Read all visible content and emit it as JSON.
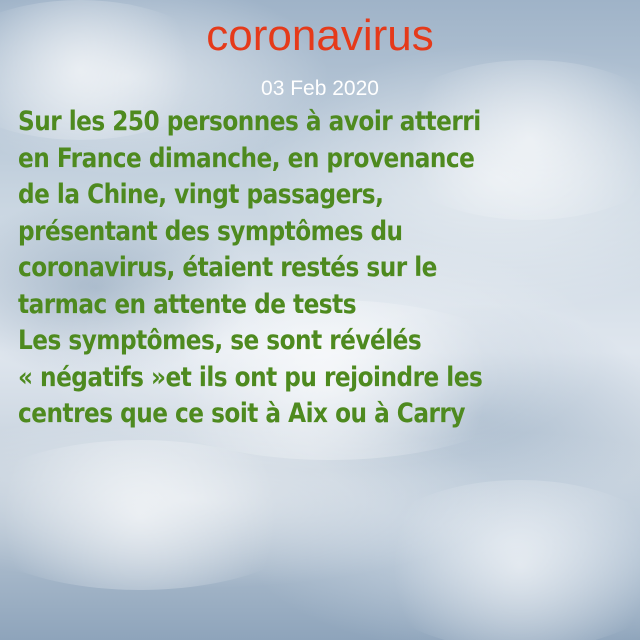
{
  "post": {
    "title": "coronavirus",
    "date": "03 Feb 2020",
    "lines": [
      "Sur les 250 personnes à avoir atterri",
      "en France dimanche, en provenance",
      "de la Chine, vingt passagers,",
      "présentant des symptômes du",
      "coronavirus, étaient restés sur le",
      "tarmac en attente de tests",
      "Les symptômes, se sont révélés",
      "« négatifs »et ils ont pu rejoindre les",
      "centres que ce soit à Aix ou à Carry"
    ]
  },
  "colors": {
    "title": "#e53a1a",
    "date": "#ffffff",
    "body": "#4e8a1f",
    "sky": "#c7d4e0"
  }
}
